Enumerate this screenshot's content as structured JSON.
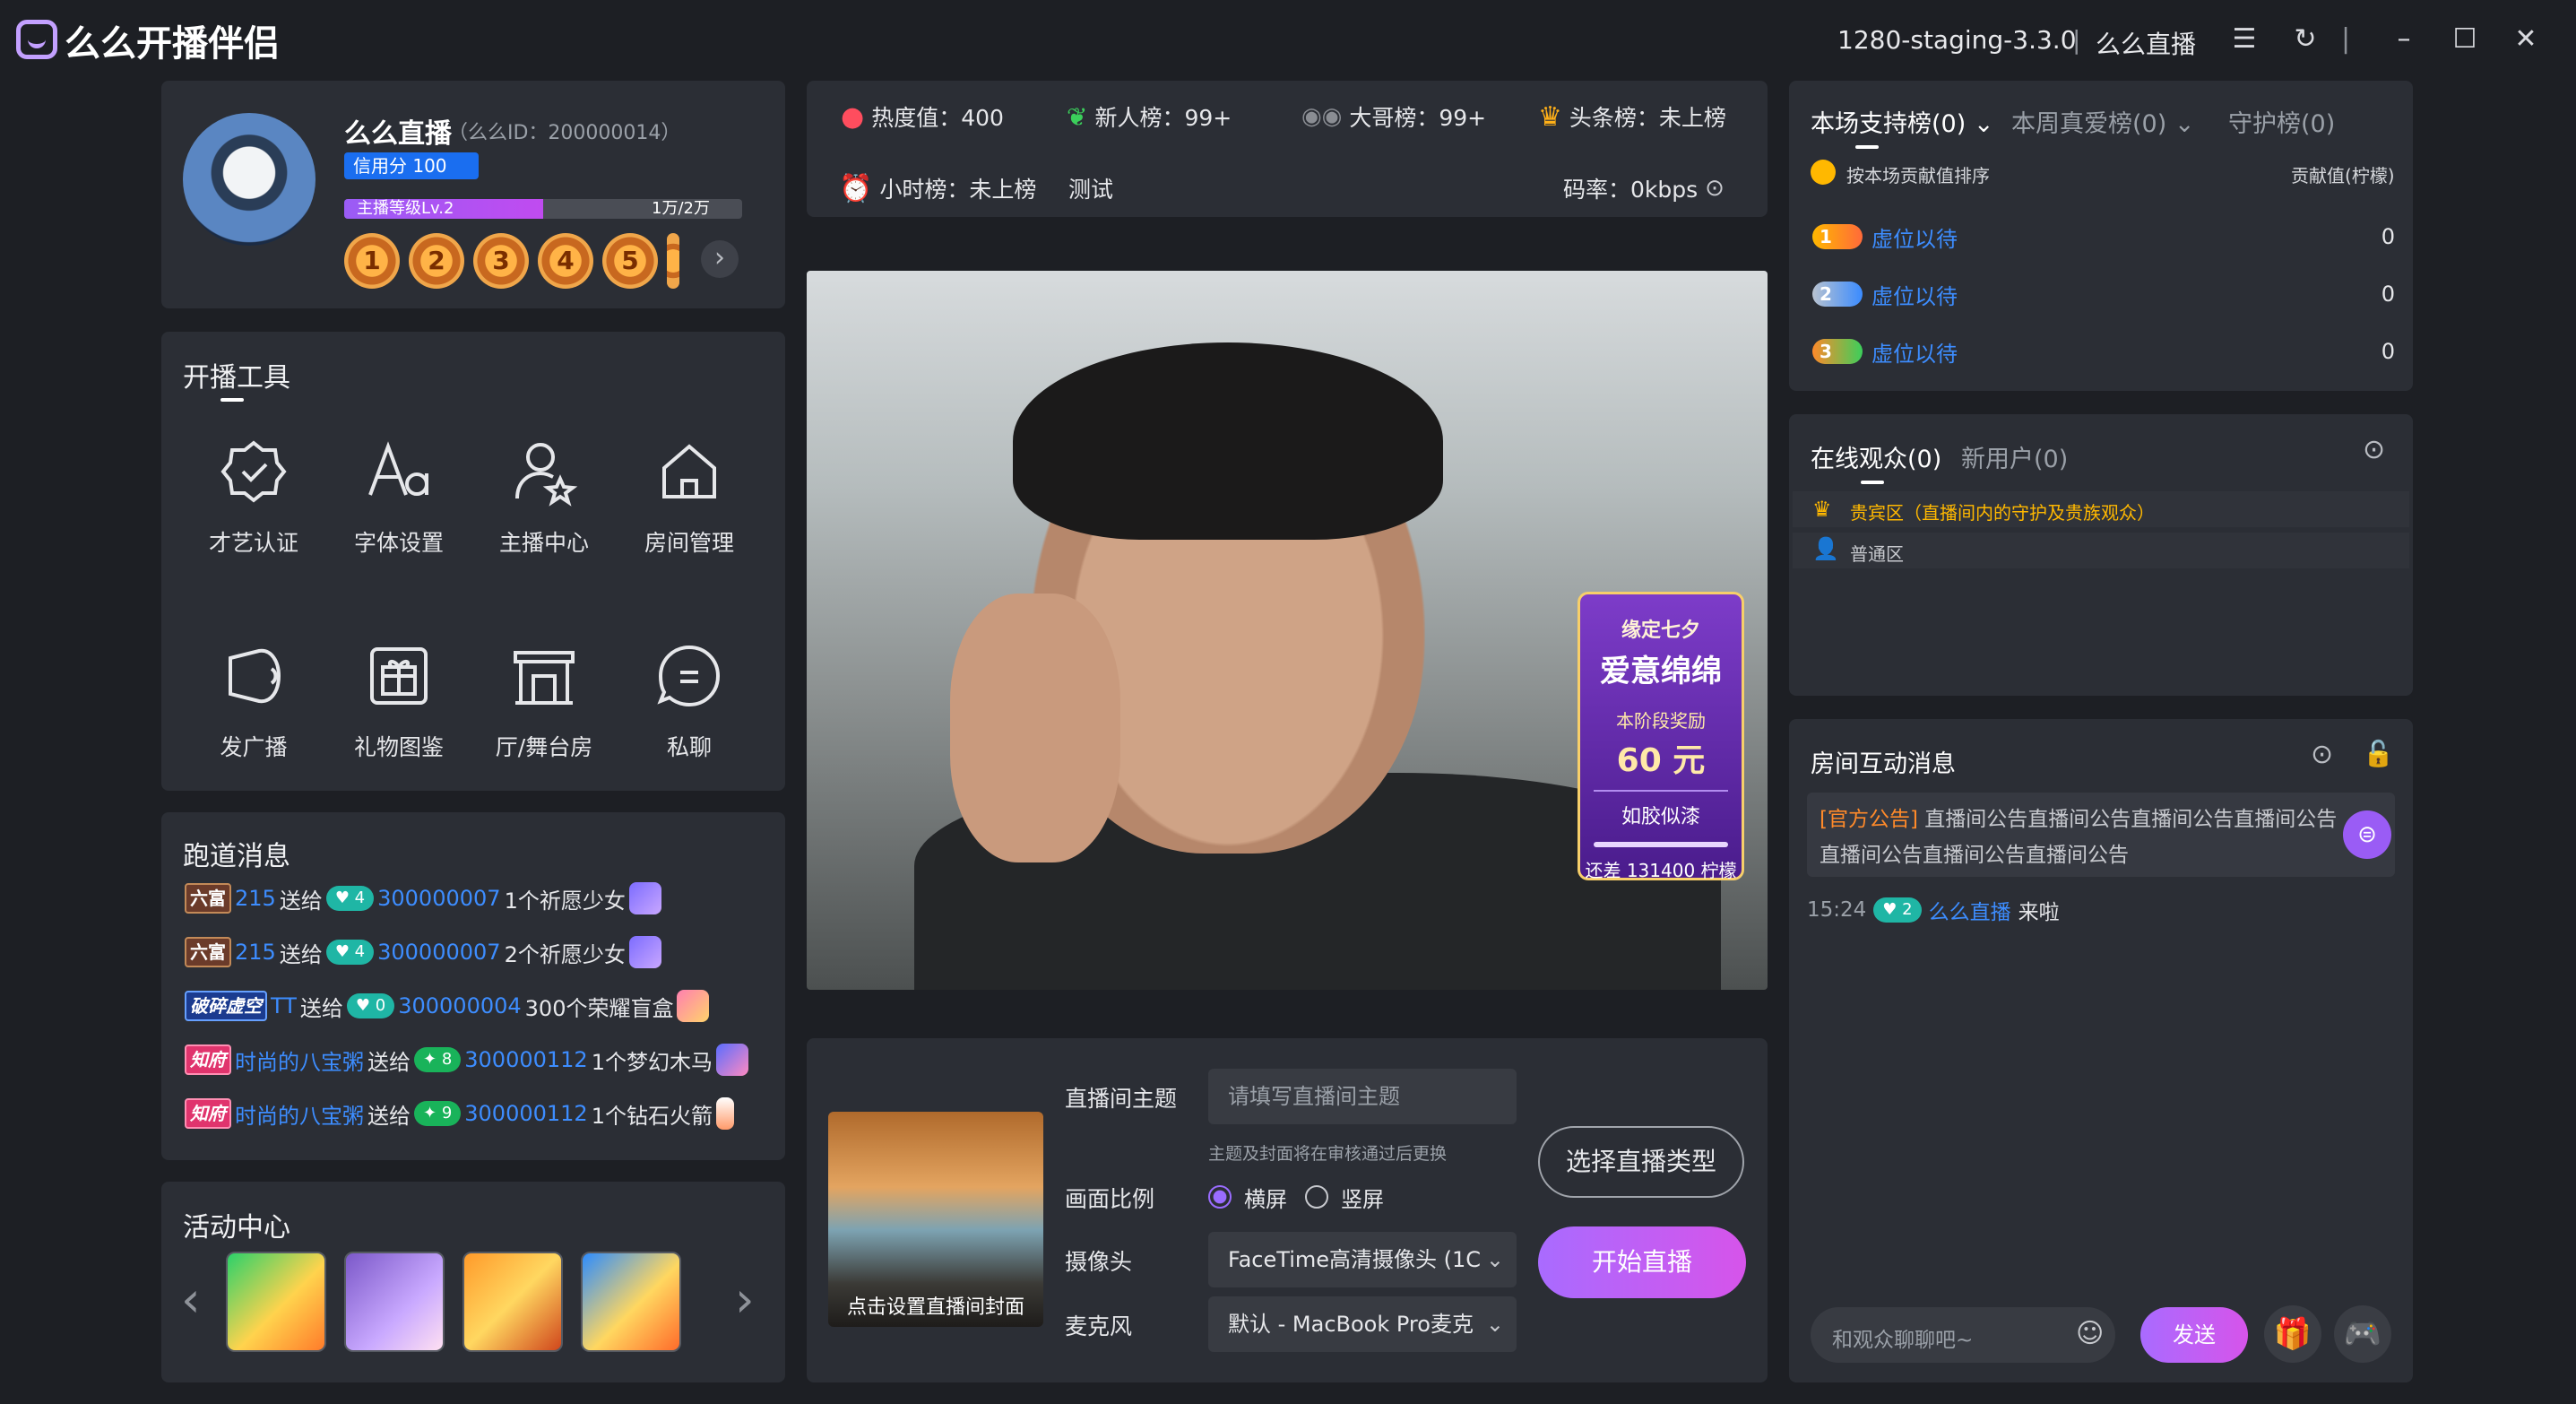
{
  "titlebar": {
    "app_name": "么么开播伴侣",
    "version": "1280-staging-3.3.0",
    "separator": "|",
    "account": "么么直播"
  },
  "profile": {
    "name": "么么直播",
    "id_text": "（么么ID：200000014）",
    "credit": "信用分 100",
    "level_label": "主播等级Lv.2",
    "level_progress": "1万/2万",
    "level_fraction": 0.5,
    "medals": [
      "1",
      "2",
      "3",
      "4",
      "5"
    ]
  },
  "tools": {
    "title": "开播工具",
    "items": [
      {
        "label": "才艺认证",
        "icon": "badge-check-icon"
      },
      {
        "label": "字体设置",
        "icon": "font-icon"
      },
      {
        "label": "主播中心",
        "icon": "user-star-icon"
      },
      {
        "label": "房间管理",
        "icon": "home-icon"
      },
      {
        "label": "发广播",
        "icon": "broadcast-icon"
      },
      {
        "label": "礼物图鉴",
        "icon": "gift-box-icon"
      },
      {
        "label": "厅/舞台房",
        "icon": "hall-icon"
      },
      {
        "label": "私聊",
        "icon": "chat-icon"
      }
    ]
  },
  "marquee": {
    "title": "跑道消息",
    "messages": [
      {
        "tag": "六富",
        "user": "215",
        "action": "送给",
        "level": "4",
        "target": "300000007",
        "gift": "1个祈愿少女"
      },
      {
        "tag": "六富",
        "user": "215",
        "action": "送给",
        "level": "4",
        "target": "300000007",
        "gift": "2个祈愿少女"
      },
      {
        "tag": "破碎虚空",
        "user": "TT",
        "action": "送给",
        "level": "0",
        "target": "300000004",
        "gift": "300个荣耀盲盒"
      },
      {
        "tag": "知府",
        "user": "时尚的八宝粥",
        "action": "送给",
        "level": "8",
        "target": "300000112",
        "gift": "1个梦幻木马"
      },
      {
        "tag": "知府",
        "user": "时尚的八宝粥",
        "action": "送给",
        "level": "9",
        "target": "300000112",
        "gift": "1个钻石火箭"
      }
    ]
  },
  "activity": {
    "title": "活动中心",
    "prev": "‹",
    "next": "›"
  },
  "stats": {
    "heat": "热度值：400",
    "newcomer": "新人榜：99+",
    "bigbro": "大哥榜：99+",
    "headline": "头条榜：未上榜",
    "hourly": "小时榜：未上榜",
    "test": "测试",
    "bitrate": "码率：0kbps"
  },
  "promo": {
    "line1": "缘定七夕",
    "line2": "爱意绵绵",
    "reward_label": "本阶段奖励",
    "reward_value": "60 元",
    "rank_name": "如胶似漆",
    "remain": "还差 131400 柠檬"
  },
  "controls": {
    "cover_label": "点击设置直播间封面",
    "topic_label": "直播间主题",
    "topic_placeholder": "请填写直播间主题",
    "topic_hint": "主题及封面将在审核通过后更换",
    "ratio_label": "画面比例",
    "ratio_options": [
      "横屏",
      "竖屏"
    ],
    "ratio_selected": "横屏",
    "camera_label": "摄像头",
    "camera_value": "FaceTime高清摄像头 (1C",
    "mic_label": "麦克风",
    "mic_value": "默认 - MacBook Pro麦克",
    "type_button": "选择直播类型",
    "start_button": "开始直播"
  },
  "ranking": {
    "tabs": [
      "本场支持榜(0)",
      "本周真爱榜(0)",
      "守护榜(0)"
    ],
    "sort_label": "按本场贡献值排序",
    "value_label": "贡献值(柠檬)",
    "rows": [
      {
        "name": "虚位以待",
        "value": "0",
        "rank": "1"
      },
      {
        "name": "虚位以待",
        "value": "0",
        "rank": "2"
      },
      {
        "name": "虚位以待",
        "value": "0",
        "rank": "3"
      }
    ]
  },
  "audience": {
    "tabs": [
      "在线观众(0)",
      "新用户(0)"
    ],
    "vip_zone": "贵宾区（直播间内的守护及贵族观众）",
    "normal_zone": "普通区"
  },
  "chat": {
    "title": "房间互动消息",
    "notice_tag": "[官方公告]",
    "notice_text": "直播间公告直播间公告直播间公告直播间公告直播间公告直播间公告直播间公告",
    "entries": [
      {
        "time": "15:24",
        "level": "2",
        "user": "么么直播",
        "text": "来啦"
      }
    ],
    "input_placeholder": "和观众聊聊吧~",
    "send": "发送"
  },
  "colors": {
    "accent": "#a96bff",
    "link": "#3d8dff",
    "panel": "#2b2e35",
    "background": "#1d1f24"
  }
}
